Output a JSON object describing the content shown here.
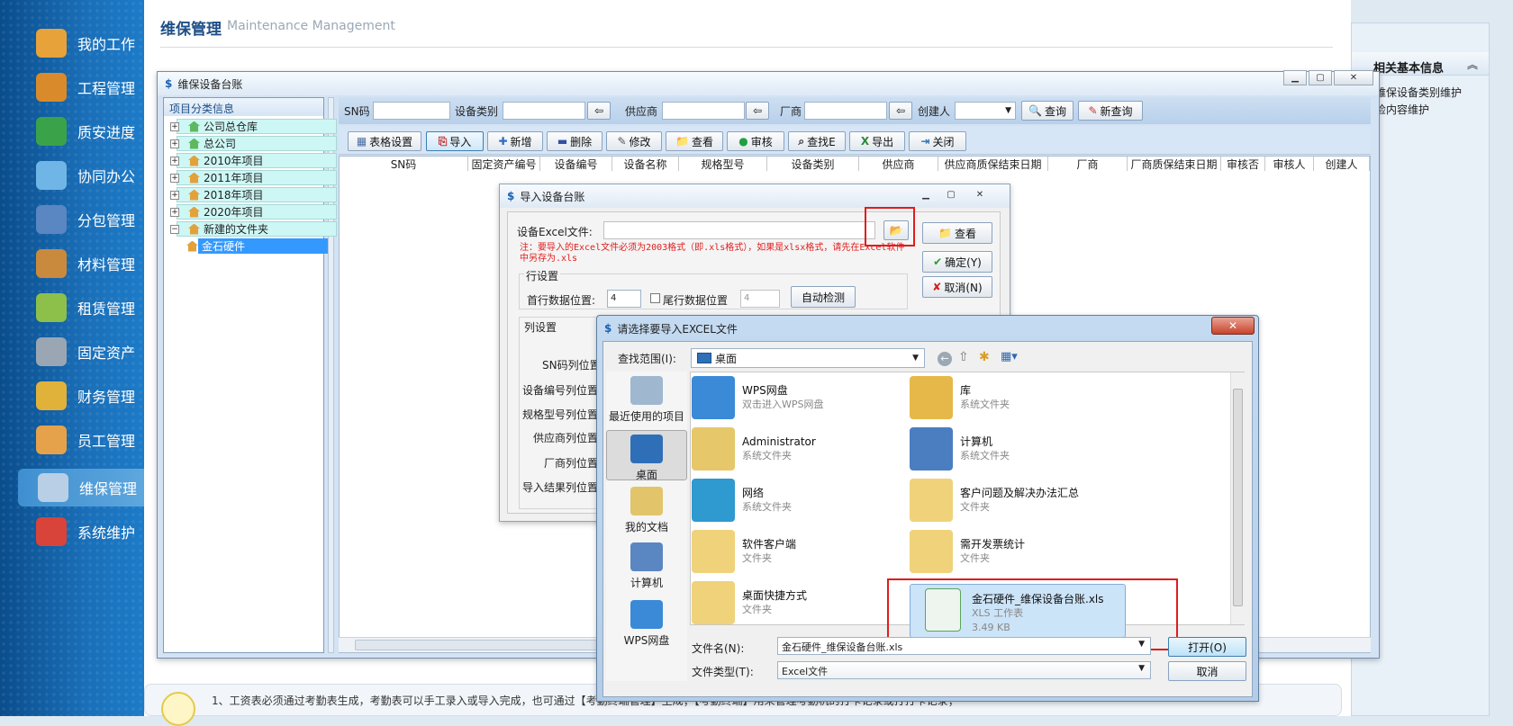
{
  "sidebar": {
    "items": [
      {
        "label": "我的工作",
        "icon": "person-icon",
        "color": "#e8a23a"
      },
      {
        "label": "工程管理",
        "icon": "worker-icon",
        "color": "#d98a2b"
      },
      {
        "label": "质安进度",
        "icon": "clock-icon",
        "color": "#3aa34a"
      },
      {
        "label": "协同办公",
        "icon": "arrows-icon",
        "color": "#6fb6e6"
      },
      {
        "label": "分包管理",
        "icon": "toolbox-icon",
        "color": "#5a86c2"
      },
      {
        "label": "材料管理",
        "icon": "box-icon",
        "color": "#c98a3d"
      },
      {
        "label": "租赁管理",
        "icon": "cubes-icon",
        "color": "#8cc04a"
      },
      {
        "label": "固定资产",
        "icon": "server-icon",
        "color": "#9aa6b4"
      },
      {
        "label": "财务管理",
        "icon": "money-icon",
        "color": "#e0b23a"
      },
      {
        "label": "员工管理",
        "icon": "people-icon",
        "color": "#e6a24a"
      },
      {
        "label": "维保管理",
        "icon": "wrench-icon",
        "color": "#b8cfe6"
      },
      {
        "label": "系统维护",
        "icon": "gear-icon",
        "color": "#d8443a"
      }
    ],
    "active_index": 10
  },
  "page": {
    "title": "维保管理",
    "subtitle": "Maintenance Management"
  },
  "right_panel": {
    "title": "相关基本信息",
    "items": [
      "维保设备类别维护",
      "检内容维护"
    ]
  },
  "ledger_window": {
    "title": "维保设备台账",
    "tree_title": "项目分类信息",
    "tree": [
      "公司总仓库",
      "总公司",
      "2010年项目",
      "2011年项目",
      "2018年项目",
      "2020年项目",
      "新建的文件夹",
      "金石硬件"
    ],
    "search": {
      "sn_label": "SN码",
      "type_label": "设备类别",
      "supplier_label": "供应商",
      "maker_label": "厂商",
      "creator_label": "创建人",
      "query_btn": "查询",
      "new_query_btn": "新查询"
    },
    "toolbar": [
      "表格设置",
      "导入",
      "新增",
      "删除",
      "修改",
      "查看",
      "审核",
      "查找E",
      "导出",
      "关闭"
    ],
    "columns": [
      "SN码",
      "固定资产编号",
      "设备编号",
      "设备名称",
      "规格型号",
      "设备类别",
      "供应商",
      "供应商质保结束日期",
      "厂商",
      "厂商质保结束日期",
      "审核否",
      "审核人",
      "创建人"
    ]
  },
  "import_dialog": {
    "title": "导入设备台账",
    "file_label": "设备Excel文件:",
    "note": "注：要导入的Excel文件必须为2003格式（即.xls格式），如果是xlsx格式，请先在Excel软件中另存为.xls",
    "btn_view": "查看",
    "btn_ok": "确定(Y)",
    "btn_cancel": "取消(N)",
    "row_section": "行设置",
    "first_row_label": "首行数据位置:",
    "first_row_value": "4",
    "last_row_label": "尾行数据位置",
    "last_row_value": "4",
    "auto_detect": "自动检测",
    "col_section": "列设置",
    "col_labels": [
      "SN码列位置",
      "设备编号列位置",
      "规格型号列位置",
      "供应商列位置",
      "厂商列位置",
      "导入结果列位置"
    ]
  },
  "file_dialog": {
    "title": "请选择要导入EXCEL文件",
    "lookin_label": "查找范围(I):",
    "lookin_value": "桌面",
    "places": [
      "最近使用的项目",
      "桌面",
      "我的文档",
      "计算机",
      "WPS网盘"
    ],
    "files": [
      {
        "name": "WPS网盘",
        "sub": "双击进入WPS网盘",
        "size": "",
        "icon": "cloud-icon"
      },
      {
        "name": "库",
        "sub": "系统文件夹",
        "size": "",
        "icon": "library-icon"
      },
      {
        "name": "Administrator",
        "sub": "系统文件夹",
        "size": "",
        "icon": "user-folder-icon"
      },
      {
        "name": "计算机",
        "sub": "系统文件夹",
        "size": "",
        "icon": "computer-icon"
      },
      {
        "name": "网络",
        "sub": "系统文件夹",
        "size": "",
        "icon": "network-icon"
      },
      {
        "name": "客户问题及解决办法汇总",
        "sub": "文件夹",
        "size": "",
        "icon": "folder-icon"
      },
      {
        "name": "软件客户端",
        "sub": "文件夹",
        "size": "",
        "icon": "folder-icon"
      },
      {
        "name": "需开发票统计",
        "sub": "文件夹",
        "size": "",
        "icon": "folder-icon"
      },
      {
        "name": "桌面快捷方式",
        "sub": "文件夹",
        "size": "",
        "icon": "folder-icon"
      },
      {
        "name": "金石硬件_维保设备台账.xls",
        "sub": "XLS 工作表",
        "size": "3.49 KB",
        "icon": "xls-icon"
      }
    ],
    "filename_label": "文件名(N):",
    "filename_value": "金石硬件_维保设备台账.xls",
    "filetype_label": "文件类型(T):",
    "filetype_value": "Excel文件",
    "open_btn": "打开(O)",
    "cancel_btn": "取消"
  },
  "footer_note": "1、工资表必须通过考勤表生成，考勤表可以手工录入或导入完成，也可通过【考勤终端管理】生成；【考勤终端】用来管理考勤机的打卡记录或打打卡记录；"
}
